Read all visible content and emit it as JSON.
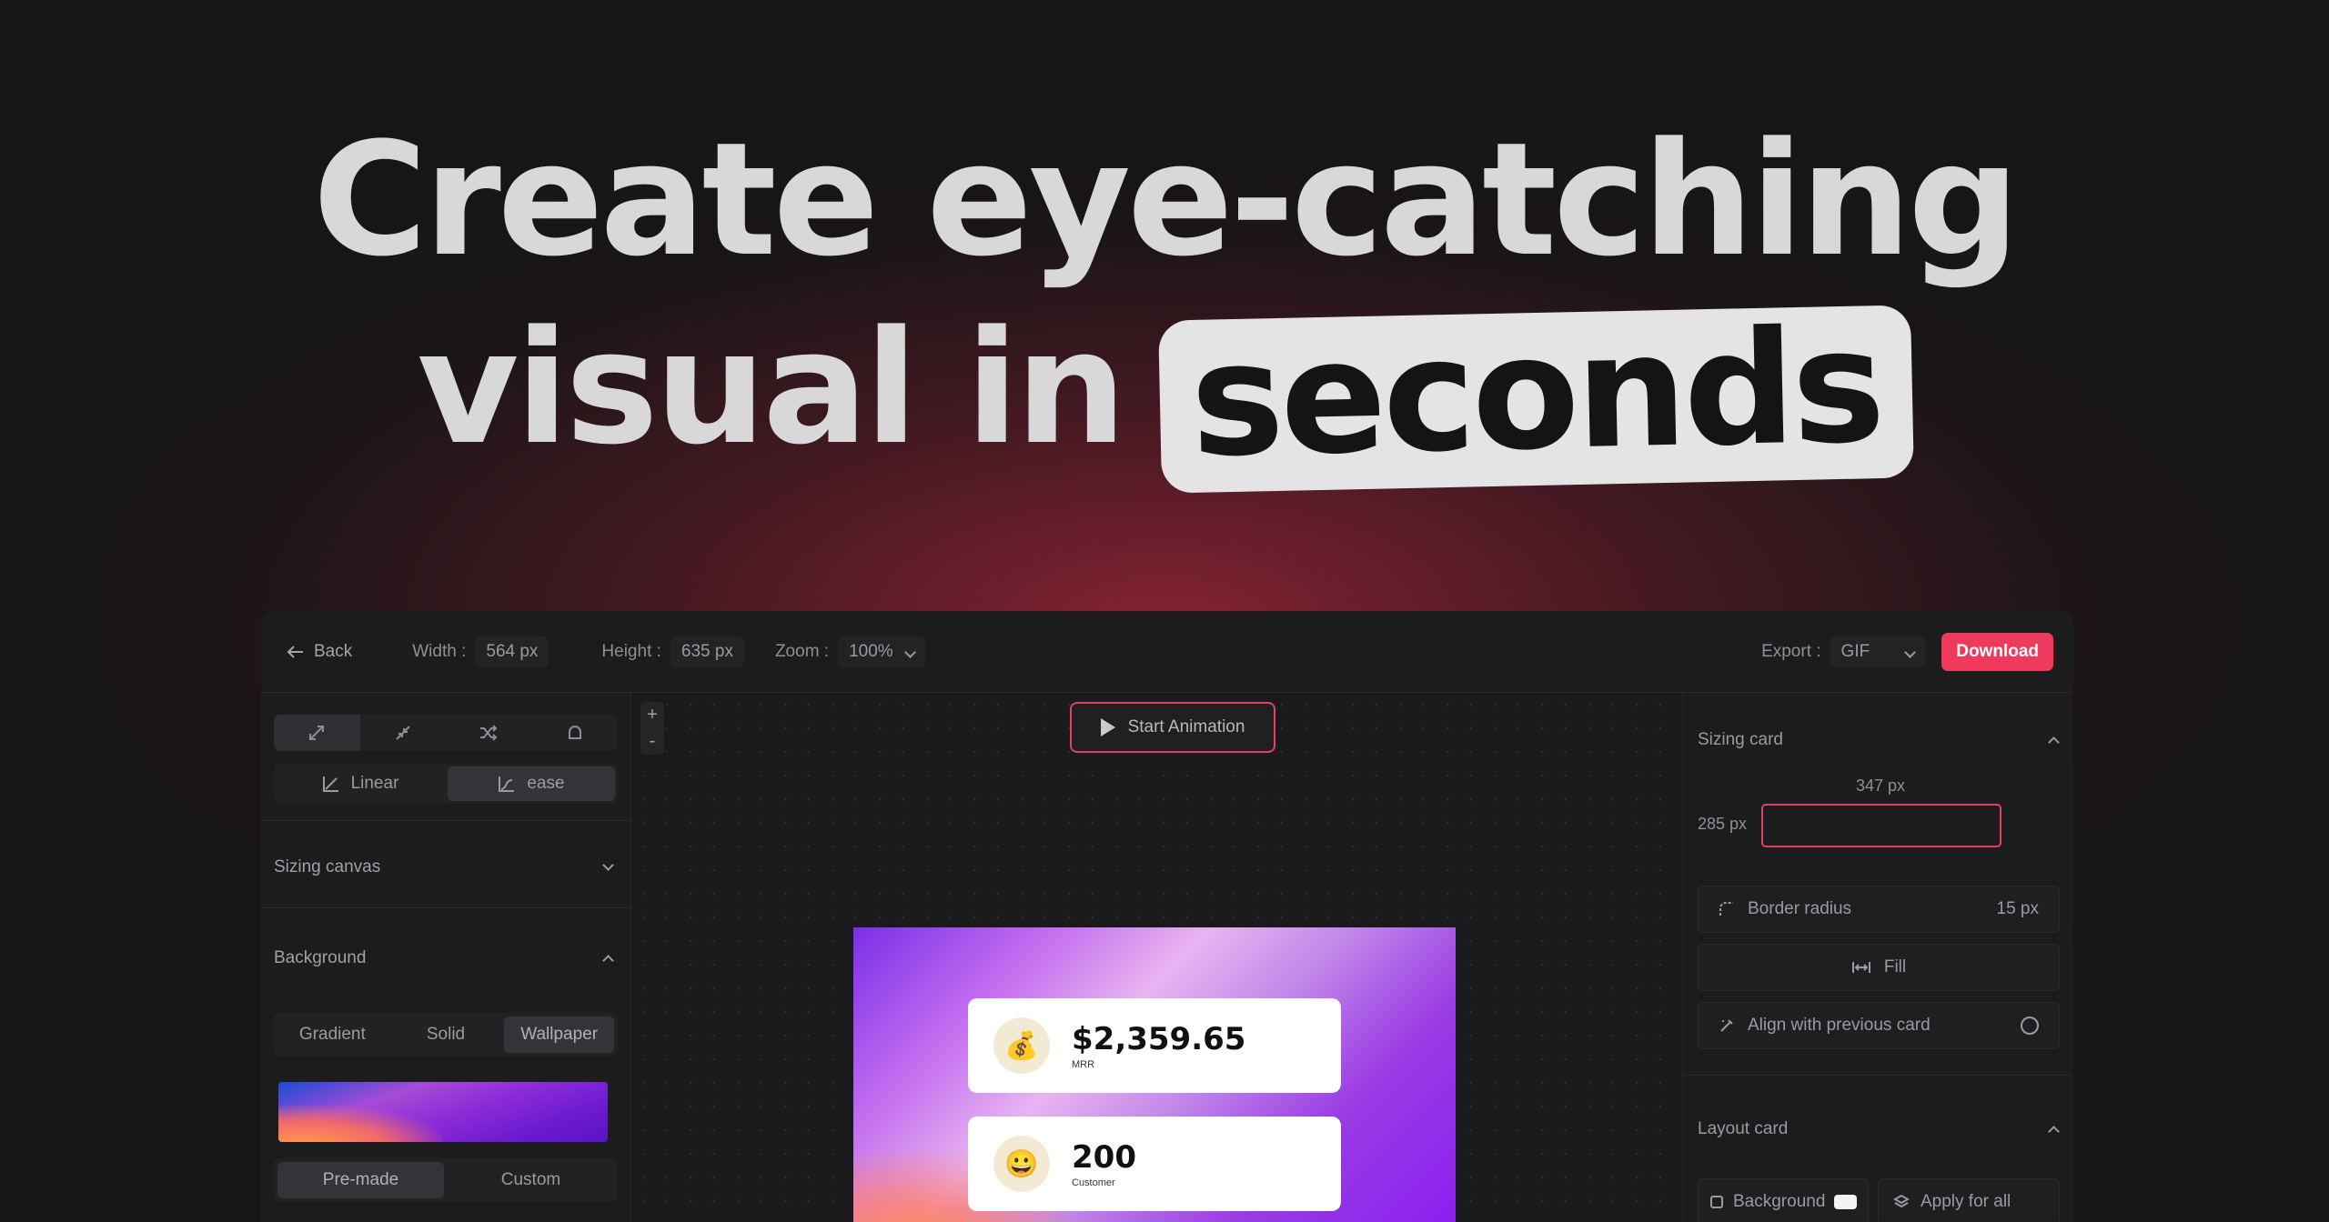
{
  "hero": {
    "line1": "Create eye-catching",
    "line2_plain": "visual in",
    "line2_highlight": "seconds"
  },
  "topbar": {
    "back": "Back",
    "width_label": "Width :",
    "width_value": "564 px",
    "height_label": "Height :",
    "height_value": "635 px",
    "zoom_label": "Zoom :",
    "zoom_value": "100%",
    "export_label": "Export :",
    "export_value": "GIF",
    "download": "Download"
  },
  "left_panel": {
    "icon_tools": [
      "expand-icon",
      "collapse-icon",
      "shuffle-icon",
      "shape-icon"
    ],
    "easing": [
      {
        "label": "Linear",
        "icon": "linear-curve-icon"
      },
      {
        "label": "ease",
        "icon": "ease-curve-icon"
      }
    ],
    "sizing_canvas": "Sizing canvas",
    "background": "Background",
    "bg_types": [
      "Gradient",
      "Solid",
      "Wallpaper"
    ],
    "bg_selected": "Wallpaper",
    "wallpaper_sources": [
      "Pre-made",
      "Custom"
    ],
    "wallpaper_selected": "Pre-made"
  },
  "canvas": {
    "zoom_in": "+",
    "zoom_out": "-",
    "start_animation": "Start Animation",
    "cards": [
      {
        "value": "$2,359.65",
        "caption": "MRR",
        "emoji": "💰"
      },
      {
        "value": "200",
        "caption": "Customer",
        "emoji": "😀"
      }
    ]
  },
  "right_panel": {
    "sizing_card": "Sizing card",
    "card_width": "347 px",
    "card_height": "285 px",
    "border_radius_label": "Border radius",
    "border_radius_value": "15 px",
    "fill": "Fill",
    "align_previous": "Align with previous card",
    "layout_card": "Layout card",
    "background": "Background",
    "apply_all": "Apply for all"
  },
  "colors": {
    "accent": "#ef3a5d",
    "background": "#161617",
    "panel": "#1c1c1e"
  }
}
